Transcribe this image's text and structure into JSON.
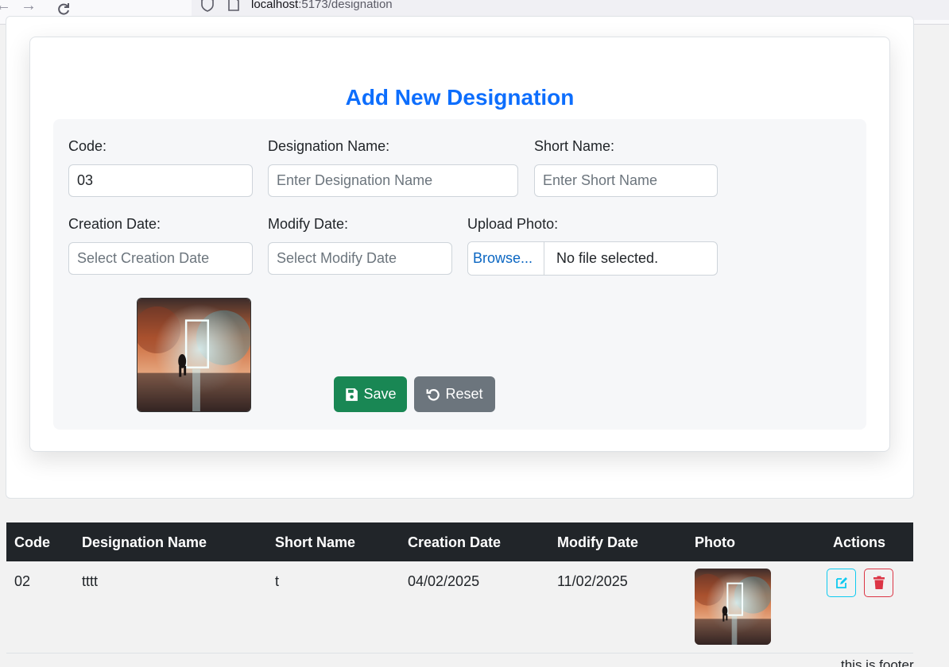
{
  "browser": {
    "url_host": "localhost",
    "url_rest": ":5173/designation"
  },
  "form": {
    "title": "Add New Designation",
    "code_label": "Code:",
    "code_value": "03",
    "designation_label": "Designation Name:",
    "designation_placeholder": "Enter Designation Name",
    "short_label": "Short Name:",
    "short_placeholder": "Enter Short Name",
    "creation_label": "Creation Date:",
    "creation_placeholder": "Select Creation Date",
    "modify_label": "Modify Date:",
    "modify_placeholder": "Select Modify Date",
    "upload_label": "Upload Photo:",
    "browse_label": "Browse...",
    "file_status": "No file selected.",
    "save_label": "Save",
    "reset_label": "Reset"
  },
  "table": {
    "headers": [
      "Code",
      "Designation Name",
      "Short Name",
      "Creation Date",
      "Modify Date",
      "Photo",
      "Actions"
    ],
    "rows": [
      {
        "code": "02",
        "name": "tttt",
        "short": "t",
        "created": "04/02/2025",
        "modified": "11/02/2025"
      }
    ]
  },
  "footer": {
    "text": "this is footer"
  },
  "colors": {
    "accent": "#0d6efd",
    "save": "#198754",
    "reset": "#6c757d",
    "edit": "#0dcaf0",
    "delete": "#dc3545",
    "table_head": "#212529"
  },
  "icons": [
    "back-arrow-icon",
    "forward-arrow-icon",
    "reload-icon",
    "shield-icon",
    "page-icon",
    "save-icon",
    "reset-icon",
    "edit-icon",
    "trash-icon"
  ]
}
